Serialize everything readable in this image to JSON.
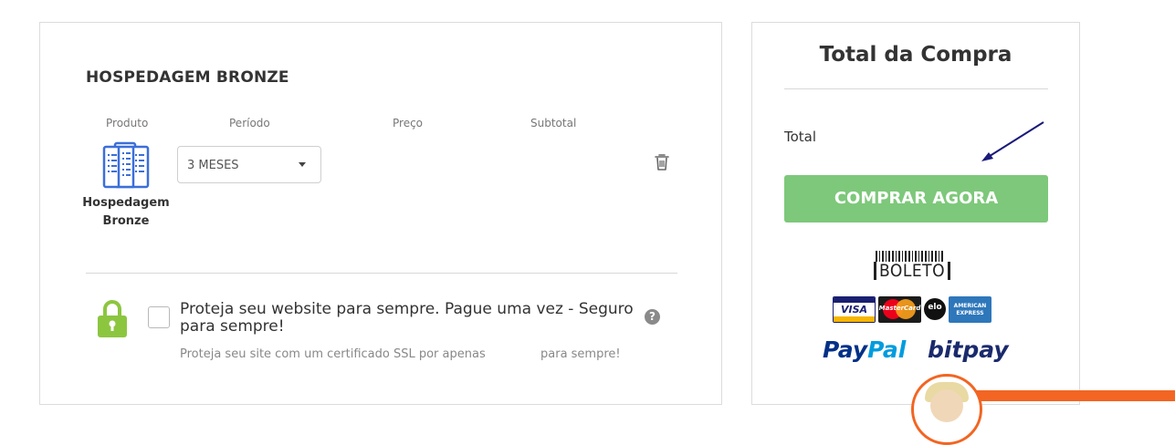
{
  "cart": {
    "product_title": "HOSPEDAGEM BRONZE",
    "columns": {
      "produto": "Produto",
      "periodo": "Período",
      "preco": "Preço",
      "subtotal": "Subtotal"
    },
    "item": {
      "name_line1": "Hospedagem",
      "name_line2": "Bronze",
      "period_value": "3 MESES",
      "icon": "server-icon"
    },
    "ssl": {
      "title": "Proteja seu website para sempre. Pague uma vez - Seguro para sempre!",
      "desc_before": "Proteja seu site com um certificado SSL por apenas",
      "desc_after": "para sempre!",
      "help_glyph": "?",
      "icon": "lock-icon",
      "checked": false
    }
  },
  "summary": {
    "heading": "Total da Compra",
    "total_label": "Total",
    "buy_label": "COMPRAR AGORA",
    "colors": {
      "buy": "#7dc87a",
      "accent": "#f26522",
      "icon_blue": "#3b6fd9",
      "lock_green": "#8cc63f"
    },
    "payments": {
      "boleto": "BOLETO",
      "visa": "VISA",
      "mastercard": "MasterCard",
      "elo": "elo",
      "amex_line1": "AMERICAN",
      "amex_line2": "EXPRESS",
      "paypal_pay": "Pay",
      "paypal_pal": "Pal",
      "bitpay": "bitpay"
    }
  }
}
